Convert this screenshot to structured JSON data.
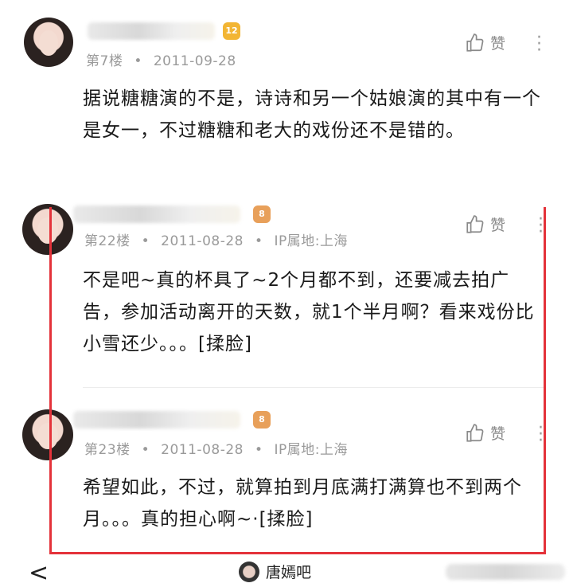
{
  "posts": [
    {
      "floor": "第7楼",
      "date": "2011-09-28",
      "ip": "",
      "level": "12",
      "like_label": "赞",
      "content": "据说糖糖演的不是，诗诗和另一个姑娘演的其中有一个是女一，不过糖糖和老大的戏份还不是错的。"
    },
    {
      "floor": "第22楼",
      "date": "2011-08-28",
      "ip": "IP属地:上海",
      "level": "8",
      "like_label": "赞",
      "content": "不是吧~真的杯具了~2个月都不到，还要减去拍广告，参加活动离开的天数，就1个半月啊？看来戏份比小雪还少。。。[揉脸]"
    },
    {
      "floor": "第23楼",
      "date": "2011-08-28",
      "ip": "IP属地:上海",
      "level": "8",
      "like_label": "赞",
      "content": "希望如此，不过，就算拍到月底满打满算也不到两个月。。。真的担心啊~·[揉脸]"
    }
  ],
  "bottom_bar": {
    "back_glyph": "<",
    "forum_name": "唐嫣吧"
  },
  "colors": {
    "highlight_border": "#e4323a",
    "badge_gold": "#f2b533",
    "badge_orange": "#e8a05a"
  }
}
